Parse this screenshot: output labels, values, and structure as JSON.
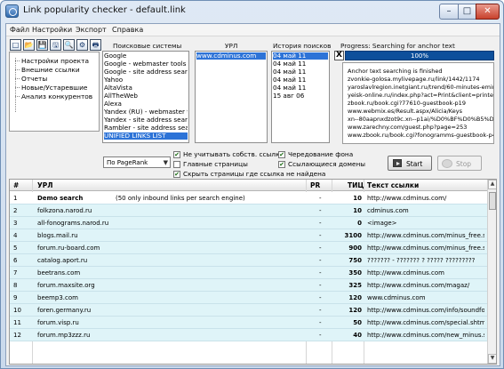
{
  "window": {
    "title": "Link popularity checker - default.link"
  },
  "menu": [
    "Файл",
    "Настройки",
    "Экспорт",
    "Справка"
  ],
  "toolbar": {
    "icons": [
      "new-icon",
      "open-icon",
      "save-icon",
      "save-as-icon",
      "search-icon",
      "settings-icon",
      "print-icon"
    ],
    "glyphs": [
      "□",
      "📂",
      "💾",
      "🖫",
      "🔍",
      "⚙",
      "🖶"
    ]
  },
  "navigation": {
    "items": [
      "Настройки проекта",
      "Внешние ссылки",
      "Отчеты",
      "Новые/Устаревшие",
      "Анализ конкурентов"
    ]
  },
  "labels": {
    "search_engines": "Поисковые системы",
    "url": "УРЛ",
    "history": "История поисков",
    "progress_status": "Progress: Searching for anchor text"
  },
  "search_engines": [
    "Google",
    "Google - webmaster tools",
    "Google - site address search",
    "Yahoo",
    "AltaVista",
    "AllTheWeb",
    "Alexa",
    "Yandex (RU) - webmaster tools",
    "Yandex - site address search",
    "Rambler - site address search",
    "UNIFIED LINKS LIST"
  ],
  "urls": [
    "www.cdminus.com"
  ],
  "history": [
    "04 май 11",
    "04 май 11",
    "04 май 11",
    "04 май 11",
    "04 май 11",
    "15 авг 06"
  ],
  "progress": {
    "value": "100%",
    "fraction": 1
  },
  "log": [
    "Anchor text searching is finished",
    "zvonkie-golosa.mylivepage.ru/link/1442/1174",
    "yaroslavlregion.inetgiant.ru/trend/60-minutes-eminem/28",
    "yeisk-online.ru/index.php?act=Print&client=printer&f=35&",
    "zbook.ru/book.cgi?77610-guestbook-p19",
    "www.webmix.es/Result.aspx/Alicia/Keys",
    "xn--80aapnxdzot9c.xn--p1ai/%D0%BF%D0%B5%D1%81%",
    "www.zarechny.com/guest.php?page=253",
    "www.zbook.ru/book.cgi?fonogramms-guestbook-p4"
  ],
  "filters": {
    "sort": "По PageRank",
    "ignore_own": "Не учитывать собств. ссылки",
    "main_pages": "Главные страницы",
    "hide_no_link": "Скрыть страницы где ссылка не найдена",
    "alternate_bg": "Чередование фона",
    "linking_domains": "Ссылающиеся домены",
    "sort_arrow": "▼",
    "check_mark": "✔"
  },
  "buttons": {
    "start": "Start",
    "stop": "Stop",
    "close": "✕",
    "minimize": "–",
    "maximize": "□",
    "cancel_search": "X"
  },
  "table": {
    "columns": [
      "#",
      "УРЛ",
      "PR",
      "ТИЦ",
      "Текст ссылки"
    ],
    "rows": [
      [
        "1",
        "Demo search",
        "(50 only inbound links per search engine)",
        "-",
        "10",
        "http://www.cdminus.com/"
      ],
      [
        "2",
        "folkzona.narod.ru",
        "",
        "-",
        "10",
        "cdminus.com"
      ],
      [
        "3",
        "all-fonograms.narod.ru",
        "",
        "-",
        "0",
        "<image>"
      ],
      [
        "4",
        "blogs.mail.ru",
        "",
        "-",
        "3100",
        "http://www.cdminus.com/minus_free.shtm"
      ],
      [
        "5",
        "forum.ru-board.com",
        "",
        "-",
        "900",
        "http://www.cdminus.com/minus_free.shtm"
      ],
      [
        "6",
        "catalog.aport.ru",
        "",
        "-",
        "750",
        "??????? - ??????? ? ????? ?????????"
      ],
      [
        "7",
        "beetrans.com",
        "",
        "-",
        "350",
        "http://www.cdminus.com"
      ],
      [
        "8",
        "forum.maxsite.org",
        "",
        "-",
        "325",
        "http://www.cdminus.com/magaz/"
      ],
      [
        "9",
        "beemp3.com",
        "",
        "-",
        "120",
        "www.cdminus.com"
      ],
      [
        "10",
        "foren.germany.ru",
        "",
        "-",
        "120",
        "http://www.cdminus.com/info/soundforge"
      ],
      [
        "11",
        "forum.visp.ru",
        "",
        "-",
        "50",
        "http://www.cdminus.com/special.shtml"
      ],
      [
        "12",
        "forum.mp3zzz.ru",
        "",
        "-",
        "40",
        "http://www.cdminus.com/new_minus.shtm"
      ]
    ]
  },
  "colors": {
    "accent": "#2d73d7",
    "progress": "#0d4f9b",
    "row_alt": "#dff4f8"
  },
  "scrollbar": {
    "up": "▲",
    "down": "▼"
  }
}
